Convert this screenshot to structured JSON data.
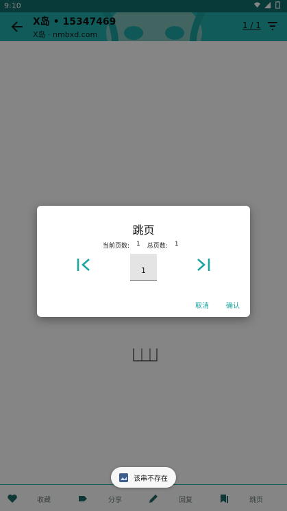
{
  "status_bar": {
    "time": "9:10"
  },
  "app_bar": {
    "title": "X岛 • 15347469",
    "subtitle": "X岛 · nmbxd.com",
    "page_indicator": "1 / 1"
  },
  "bottom_nav": {
    "items": [
      {
        "label": "收藏",
        "icon": "heart-icon"
      },
      {
        "label": "分享",
        "icon": "tag-icon"
      },
      {
        "label": "回复",
        "icon": "pencil-icon"
      },
      {
        "label": "跳页",
        "icon": "bookmark-icon"
      }
    ]
  },
  "dialog": {
    "title": "跳页",
    "current_label": "当前页数:",
    "current_value": "1",
    "total_label": "总页数:",
    "total_value": "1",
    "input_value": "1",
    "cancel_label": "取消",
    "confirm_label": "确认"
  },
  "toast": {
    "text": "该串不存在",
    "icon": "app-icon"
  },
  "colors": {
    "accent": "#1aa5a1",
    "app_bar": "#22b1ad",
    "status_bar": "#0f6f6e"
  }
}
